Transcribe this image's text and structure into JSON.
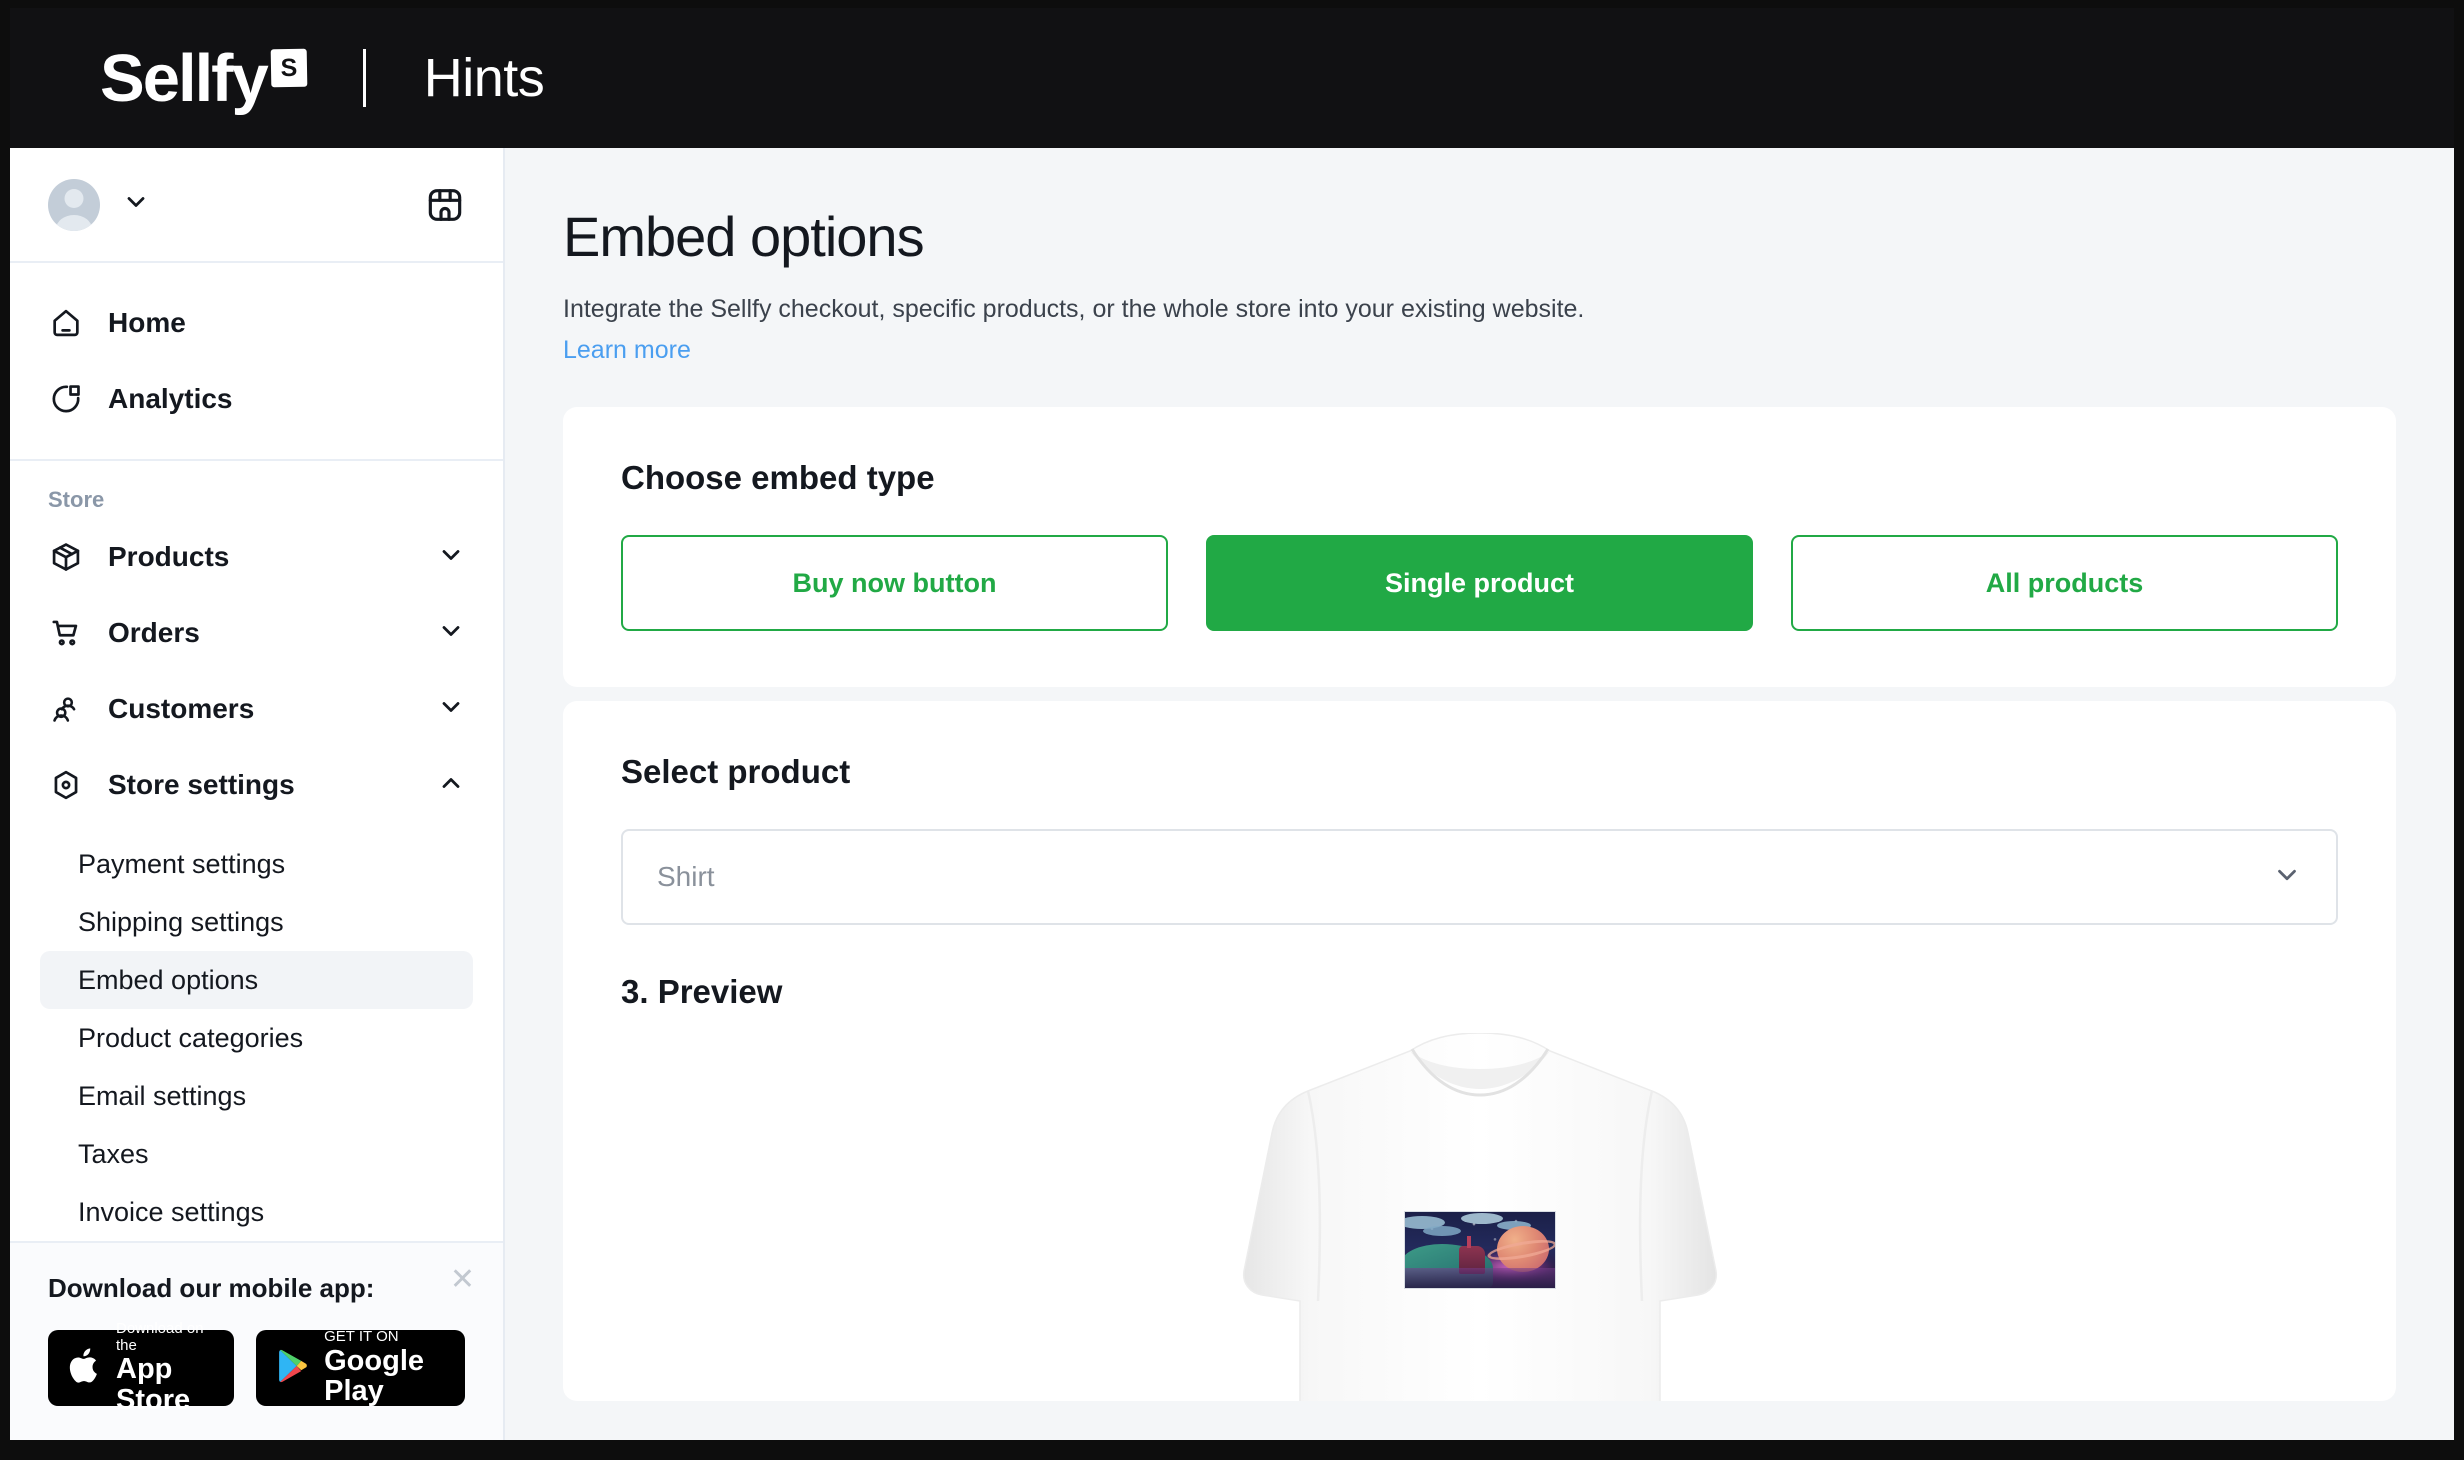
{
  "header": {
    "logo_text": "Sellfy",
    "logo_badge": "S",
    "divider": "|",
    "title": "Hints"
  },
  "sidebar": {
    "account": {
      "avatar_icon": "user-avatar-icon",
      "chevron_icon": "chevron-down-icon",
      "store_icon": "storefront-icon"
    },
    "nav_primary": [
      {
        "label": "Home",
        "icon": "home-icon"
      },
      {
        "label": "Analytics",
        "icon": "pie-chart-icon"
      }
    ],
    "section_label": "Store",
    "nav_store": [
      {
        "label": "Products",
        "icon": "package-box-icon",
        "chevron": "chevron-down-icon",
        "expanded": false
      },
      {
        "label": "Orders",
        "icon": "shopping-cart-icon",
        "chevron": "chevron-down-icon",
        "expanded": false
      },
      {
        "label": "Customers",
        "icon": "people-group-icon",
        "chevron": "chevron-down-icon",
        "expanded": false
      },
      {
        "label": "Store settings",
        "icon": "settings-target-icon",
        "chevron": "chevron-up-icon",
        "expanded": true
      }
    ],
    "store_settings_children": [
      {
        "label": "Payment settings",
        "active": false
      },
      {
        "label": "Shipping settings",
        "active": false
      },
      {
        "label": "Embed options",
        "active": true
      },
      {
        "label": "Product categories",
        "active": false
      },
      {
        "label": "Email settings",
        "active": false
      },
      {
        "label": "Taxes",
        "active": false
      },
      {
        "label": "Invoice settings",
        "active": false
      }
    ],
    "promo": {
      "title": "Download our mobile app:",
      "close_icon": "close-icon",
      "app_store": {
        "sub": "Download on the",
        "main": "App Store",
        "icon": "apple-logo-icon"
      },
      "google_play": {
        "sub": "GET IT ON",
        "main": "Google Play",
        "icon": "google-play-icon"
      }
    }
  },
  "main": {
    "page_title": "Embed options",
    "page_subtitle": "Integrate the Sellfy checkout, specific products, or the whole store into your existing website.",
    "learn_more": "Learn more",
    "embed_type_heading": "Choose embed type",
    "embed_types": [
      {
        "label": "Buy now button",
        "active": false
      },
      {
        "label": "Single product",
        "active": true
      },
      {
        "label": "All products",
        "active": false
      }
    ],
    "select_product_heading": "Select product",
    "select_product_value": "Shirt",
    "select_chevron_icon": "chevron-down-icon",
    "preview_heading": "3. Preview",
    "preview_item": "white-crewneck-sweatshirt-with-space-graphic"
  },
  "colors": {
    "brand_green": "#21a945",
    "header_black": "#111113",
    "page_bg": "#f4f6f8",
    "link_blue": "#4a9ef0",
    "muted_text": "#8a97a8"
  }
}
